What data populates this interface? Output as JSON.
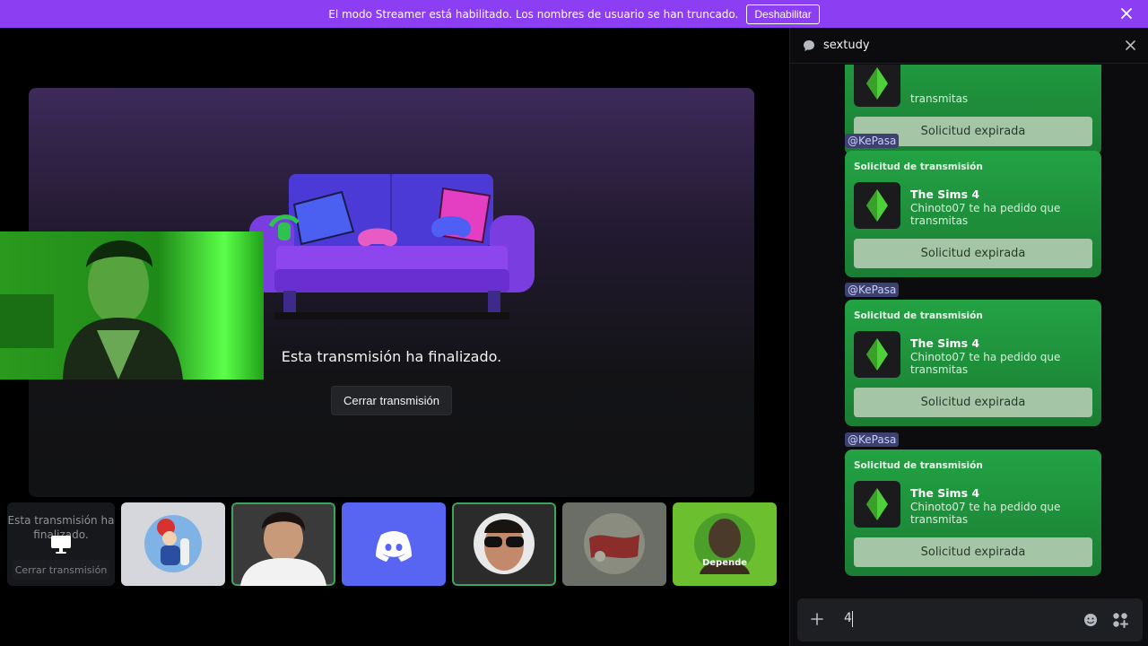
{
  "banner": {
    "text": "El modo Streamer está habilitado. Los nombres de usuario se han truncado.",
    "button": "Deshabilitar",
    "close_icon": "close-icon"
  },
  "stage": {
    "ended_text": "Esta transmisión ha finalizado.",
    "close_button": "Cerrar transmisión"
  },
  "strip": {
    "stream_tile_text": "Esta transmisión ha finalizado.",
    "stream_tile_close": "Cerrar transmisión",
    "avatar_badge": "Depende"
  },
  "chat": {
    "title": "sextudy",
    "first_card_desc_tail": "transmitas",
    "first_card_button": "Solicitud expirada",
    "messages": [
      {
        "mention": "@KePasa",
        "header": "Solicitud de transmisión",
        "game": "The Sims 4",
        "desc": "Chinoto07 te ha pedido que transmitas",
        "button": "Solicitud expirada"
      },
      {
        "mention": "@KePasa",
        "header": "Solicitud de transmisión",
        "game": "The Sims 4",
        "desc": "Chinoto07 te ha pedido que transmitas",
        "button": "Solicitud expirada"
      },
      {
        "mention": "@KePasa",
        "header": "Solicitud de transmisión",
        "game": "The Sims 4",
        "desc": "Chinoto07 te ha pedido que transmitas",
        "button": "Solicitud expirada"
      }
    ],
    "input_value": "4"
  },
  "colors": {
    "banner": "#8c3ef2",
    "card_green": "#23a344",
    "discord_blurple": "#5865f2",
    "lime": "#6cbf2f"
  }
}
